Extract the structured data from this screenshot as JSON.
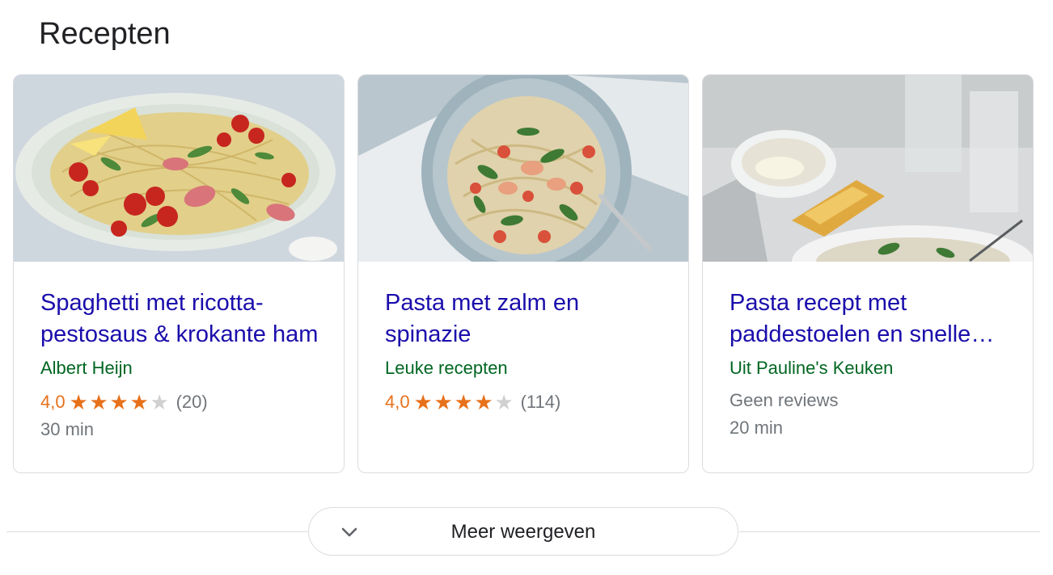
{
  "section": {
    "title": "Recepten"
  },
  "recipes": [
    {
      "title": "Spaghetti met ricotta-pestosaus & krokante ham",
      "source": "Albert Heijn",
      "rating": "4,0",
      "stars_full": 4,
      "stars_total": 5,
      "review_count": "(20)",
      "time": "30 min",
      "image_icon": "pasta-tomato-platter-photo"
    },
    {
      "title": "Pasta met zalm en spinazie",
      "source": "Leuke recepten",
      "rating": "4,0",
      "stars_full": 4,
      "stars_total": 5,
      "review_count": "(114)",
      "image_icon": "pasta-salmon-bowl-photo"
    },
    {
      "title": "Pasta recept met paddestoelen en snelle saus",
      "source": "Uit Pauline's Keuken",
      "no_reviews": "Geen reviews",
      "time": "20 min",
      "image_icon": "table-bread-bowl-photo"
    }
  ],
  "more_button": {
    "label": "Meer weergeven",
    "icon": "chevron-down-icon"
  },
  "colors": {
    "title_link": "#1a0dab",
    "source_green": "#006621",
    "rating_orange": "#e7711b",
    "meta_grey": "#70757a",
    "border": "#dadce0"
  }
}
